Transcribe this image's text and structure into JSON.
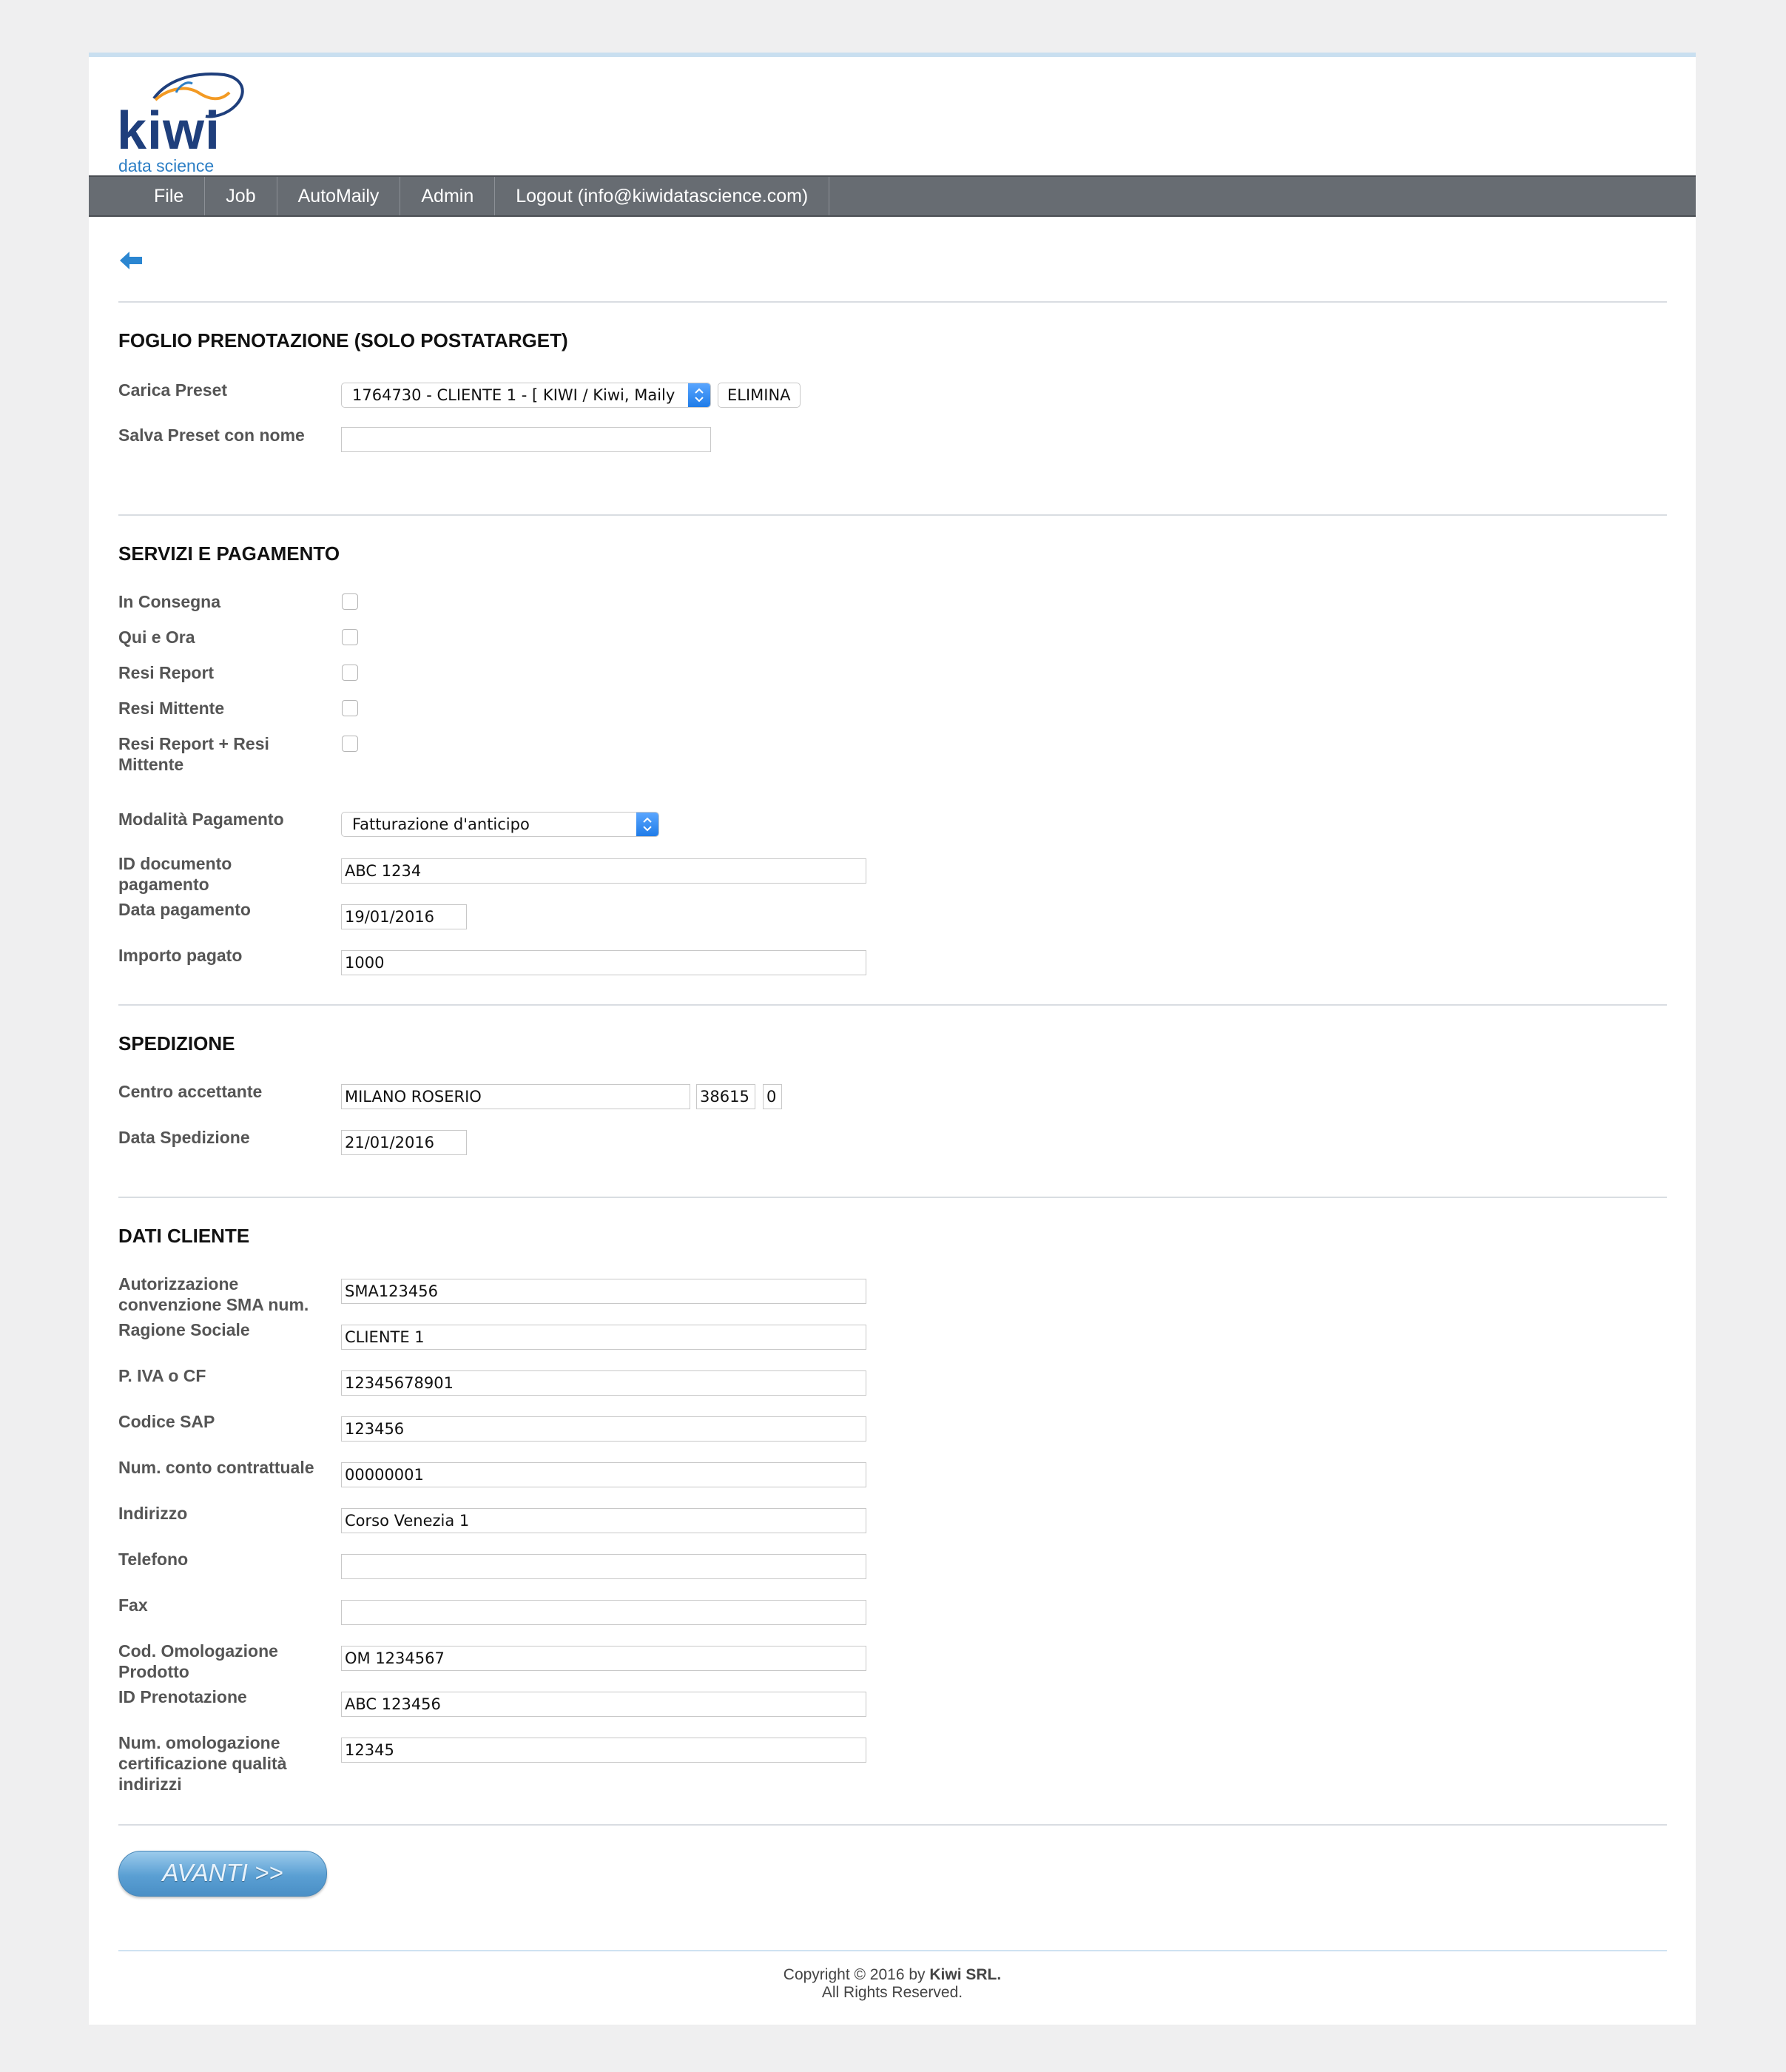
{
  "logo": {
    "word": "kiwi",
    "subtitle": "data science"
  },
  "nav": [
    "File",
    "Job",
    "AutoMaily",
    "Admin",
    "Logout (info@kiwidatascience.com)"
  ],
  "section1": {
    "title": "FOGLIO PRENOTAZIONE (SOLO POSTATARGET)",
    "carica_label": "Carica Preset",
    "carica_value": "1764730 - CLIENTE 1 - [ KIWI / Kiwi, Maily",
    "elimina_label": "ELIMINA",
    "salva_label": "Salva Preset con nome",
    "salva_value": ""
  },
  "section2": {
    "title": "SERVIZI E PAGAMENTO",
    "checks": [
      "In Consegna",
      "Qui e Ora",
      "Resi Report",
      "Resi Mittente",
      "Resi Report + Resi Mittente"
    ],
    "modalita_label": "Modalità Pagamento",
    "modalita_value": "Fatturazione d'anticipo",
    "id_doc_label": "ID documento pagamento",
    "id_doc_value": "ABC 1234",
    "data_pag_label": "Data pagamento",
    "data_pag_value": "19/01/2016",
    "importo_label": "Importo pagato",
    "importo_value": "1000"
  },
  "section3": {
    "title": "SPEDIZIONE",
    "centro_label": "Centro accettante",
    "centro_value": "MILANO ROSERIO",
    "centro_code": "38615",
    "centro_extra": "0",
    "data_sped_label": "Data Spedizione",
    "data_sped_value": "21/01/2016"
  },
  "section4": {
    "title": "DATI CLIENTE",
    "fields": [
      {
        "label": "Autorizzazione convenzione SMA num.",
        "value": "SMA123456"
      },
      {
        "label": "Ragione Sociale",
        "value": "CLIENTE 1"
      },
      {
        "label": "P. IVA o CF",
        "value": "12345678901"
      },
      {
        "label": "Codice SAP",
        "value": "123456"
      },
      {
        "label": "Num. conto contrattuale",
        "value": "00000001"
      },
      {
        "label": "Indirizzo",
        "value": "Corso Venezia 1"
      },
      {
        "label": "Telefono",
        "value": ""
      },
      {
        "label": "Fax",
        "value": ""
      },
      {
        "label": "Cod. Omologazione Prodotto",
        "value": "OM 1234567"
      },
      {
        "label": "ID Prenotazione",
        "value": "ABC 123456"
      },
      {
        "label": "Num. omologazione certificazione qualità indirizzi",
        "value": "12345"
      }
    ]
  },
  "avanti_label": "AVANTI >>",
  "footer": {
    "prefix": "Copyright © 2016 by ",
    "company": "Kiwi SRL.",
    "line2": "All Rights Reserved."
  },
  "colors": {
    "nav_bg": "#676c72",
    "accent_blue": "#2d7fc5",
    "logo_navy": "#1f3f7c"
  },
  "icons": {
    "back": "back-arrow-icon",
    "select_arrows": "chevron-updown-icon"
  }
}
